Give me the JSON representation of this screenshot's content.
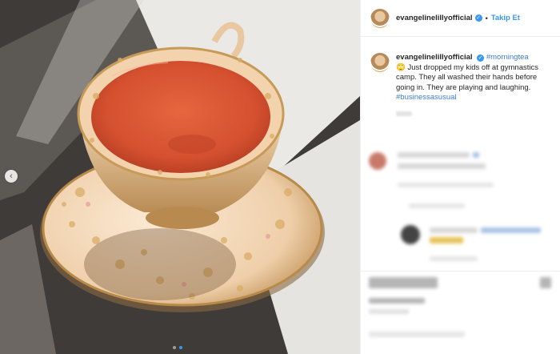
{
  "post": {
    "username": "evangelinelillyofficial",
    "verified_symbol": "✓",
    "follow_label": "Takip Et",
    "separator": "•",
    "caption": {
      "username": "evangelinelillyofficial",
      "hashtag_top": "#morningtea",
      "emoji": "🙄",
      "text": "Just dropped my kids off at gymnastics camp. They all washed their hands before going in. They are playing and laughing.",
      "hashtag_bottom": "#businessasusual"
    }
  },
  "carousel": {
    "prev_icon": "‹",
    "slides": 2,
    "active_index": 1
  },
  "colors": {
    "accent": "#3897f0",
    "tea": "#d8583a",
    "saucer": "#f3dcc6"
  }
}
